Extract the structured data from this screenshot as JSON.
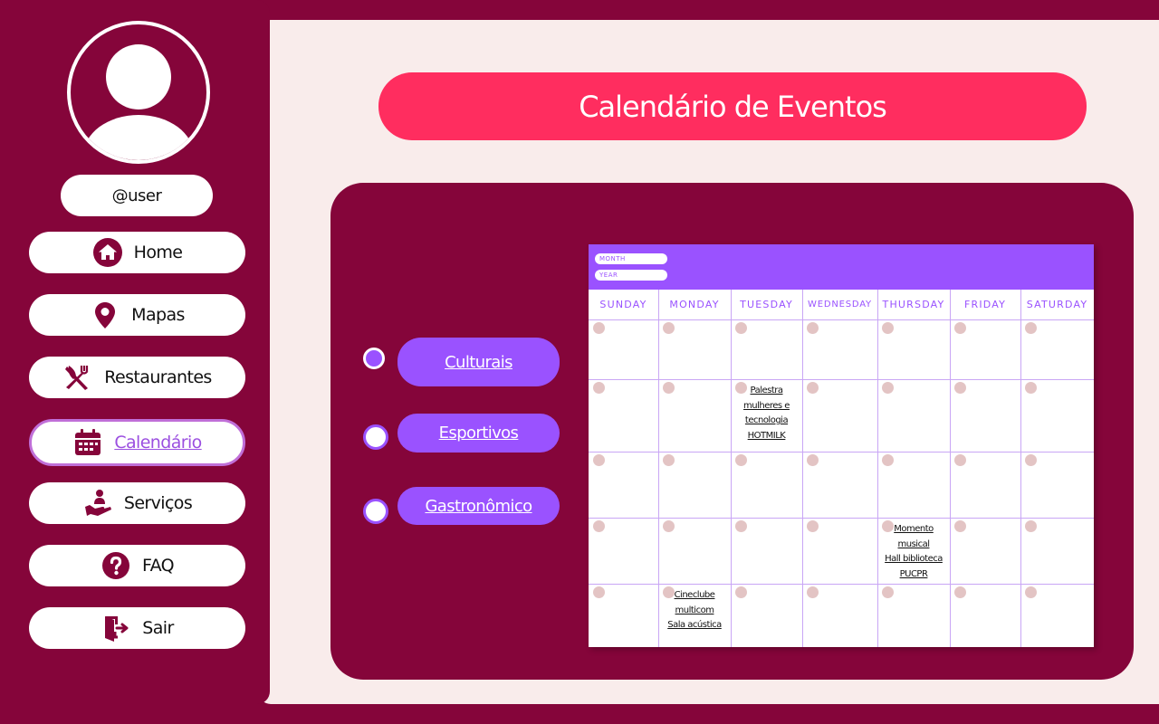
{
  "colors": {
    "brand": "#85053a",
    "background": "#f9eceb",
    "accent_pink": "#ff2d5f",
    "accent_purple": "#9a52ff"
  },
  "sidebar": {
    "avatar_icon": "user-avatar-icon",
    "username": "@user",
    "items": [
      {
        "label": "Home",
        "icon": "home-icon"
      },
      {
        "label": "Mapas",
        "icon": "map-pin-icon"
      },
      {
        "label": "Restaurantes",
        "icon": "utensils-icon"
      },
      {
        "label": "Calendário",
        "icon": "calendar-icon",
        "active": true
      },
      {
        "label": "Serviços",
        "icon": "service-hand-icon"
      },
      {
        "label": "FAQ",
        "icon": "question-icon"
      },
      {
        "label": "Sair",
        "icon": "exit-icon"
      }
    ]
  },
  "main": {
    "title": "Calendário de Eventos",
    "filters": [
      {
        "label": "Culturais",
        "selected": true
      },
      {
        "label": "Esportivos",
        "selected": false
      },
      {
        "label": "Gastronômico",
        "selected": false
      }
    ]
  },
  "calendar": {
    "month_placeholder": "MONTH",
    "year_placeholder": "YEAR",
    "days": [
      "SUNDAY",
      "MONDAY",
      "TUESDAY",
      "WEDNESDAY",
      "THURSDAY",
      "FRIDAY",
      "SATURDAY"
    ],
    "events": [
      {
        "week": 1,
        "day": 2,
        "text": "Palestra\nmulheres e\ntecnologia\nHOTMILK"
      },
      {
        "week": 3,
        "day": 4,
        "text": "Momento musical\nHall  biblioteca\nPUCPR "
      },
      {
        "week": 4,
        "day": 1,
        "text": "Cineclube\nmulticom\nSala acústica"
      }
    ]
  }
}
